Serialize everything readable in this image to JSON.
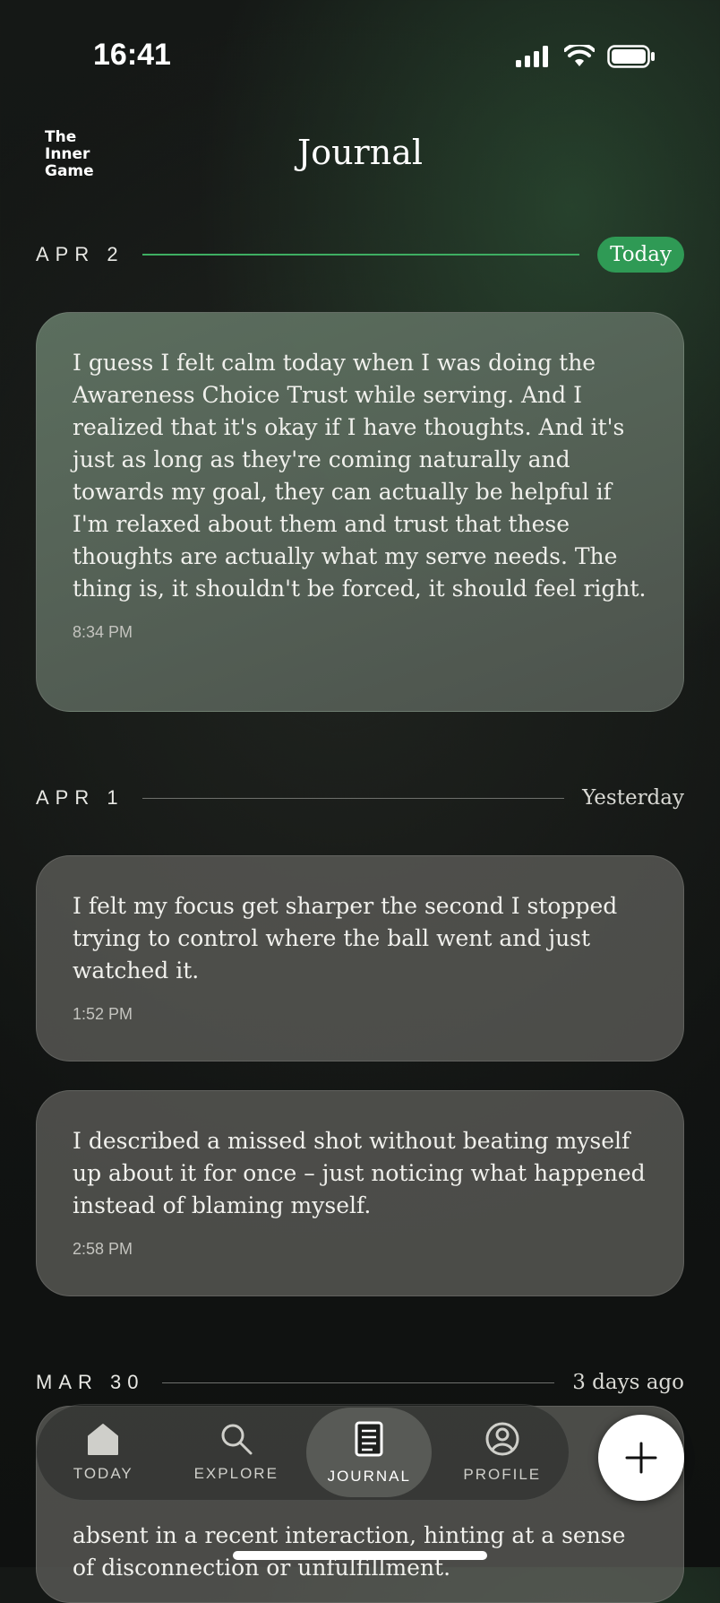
{
  "status_bar": {
    "time": "16:41",
    "icons": [
      "signal-icon",
      "wifi-icon",
      "battery-icon"
    ]
  },
  "header": {
    "logo_lines": [
      "The",
      "Inner",
      "Game"
    ],
    "title": "Journal"
  },
  "colors": {
    "accent_green": "#2f9a55",
    "today_line": "#3eae62",
    "card_bg": "#62635e",
    "fab_bg": "#ffffff"
  },
  "days": [
    {
      "date": "APR 2",
      "relative": "Today",
      "entries": [
        {
          "text": "I guess I felt calm today when I was doing the Awareness Choice Trust while serving. And I realized that it's okay if I have thoughts. And it's just as long as they're coming naturally and towards my goal, they can actually be helpful if I'm relaxed about them and trust that these thoughts are actually what my serve needs. The thing is, it shouldn't be forced, it should feel right.",
          "time": "8:34 PM"
        }
      ]
    },
    {
      "date": "APR 1",
      "relative": "Yesterday",
      "entries": [
        {
          "text": "I felt my focus get sharper the second I stopped trying to control where the ball went and just watched it.",
          "time": "1:52 PM"
        },
        {
          "text": "I described a missed shot without beating myself up about it for once – just noticing what happened instead of blaming myself.",
          "time": "2:58 PM"
        }
      ]
    },
    {
      "date": "MAR 30",
      "relative": "3 days ago",
      "entries": [
        {
          "text": "absent in a recent interaction, hinting at a sense of disconnection or unfulfillment."
        }
      ]
    }
  ],
  "tab_bar": {
    "tabs": [
      {
        "label": "TODAY",
        "icon": "home-icon",
        "active": false
      },
      {
        "label": "EXPLORE",
        "icon": "search-icon",
        "active": false
      },
      {
        "label": "JOURNAL",
        "icon": "journal-icon",
        "active": true
      },
      {
        "label": "PROFILE",
        "icon": "profile-icon",
        "active": false
      }
    ],
    "fab_icon": "plus-icon"
  }
}
